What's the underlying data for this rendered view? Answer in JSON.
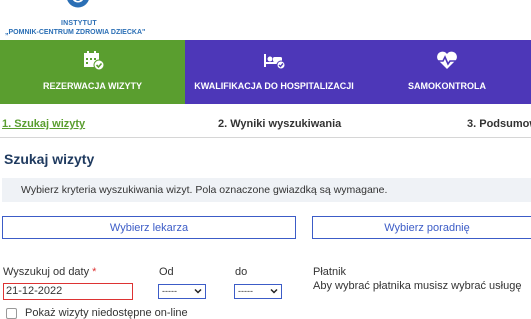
{
  "brand": {
    "name": "INSTYTUT",
    "subtitle": "„POMNIK-CENTRUM ZDROWIA DZIECKA\"",
    "color": "#2b6fb5"
  },
  "nav": {
    "tabs": [
      {
        "label": "REZERWACJA WIZYTY",
        "icon": "calendar-check-icon",
        "active": true
      },
      {
        "label": "KWALIFIKACJA DO HOSPITALIZACJI",
        "icon": "hospital-bed-icon",
        "active": false
      },
      {
        "label": "SAMOKONTROLA",
        "icon": "heart-pulse-icon",
        "active": false
      }
    ],
    "colors": {
      "bar": "#4d37b8",
      "active": "#5a9e2f"
    }
  },
  "steps": [
    {
      "label": "1. Szukaj wizyty",
      "active": true
    },
    {
      "label": "2. Wyniki wyszukiwania",
      "active": false
    },
    {
      "label": "3. Podsumow",
      "active": false
    }
  ],
  "page": {
    "title": "Szukaj wizyty",
    "info": "Wybierz kryteria wyszukiwania wizyt. Pola oznaczone gwiazdką są wymagane."
  },
  "buttons": {
    "doctor": "Wybierz lekarza",
    "clinic": "Wybierz poradnię"
  },
  "form": {
    "date_label": "Wyszukuj od daty",
    "required_mark": "*",
    "date_value": "21-12-2022",
    "from_label": "Od",
    "from_value": "-----",
    "to_label": "do",
    "to_value": "-----",
    "payer_label": "Płatnik",
    "payer_hint": "Aby wybrać płatnika musisz wybrać usługę",
    "unavailable_label": "Pokaż wizyty niedostępne on-line"
  }
}
